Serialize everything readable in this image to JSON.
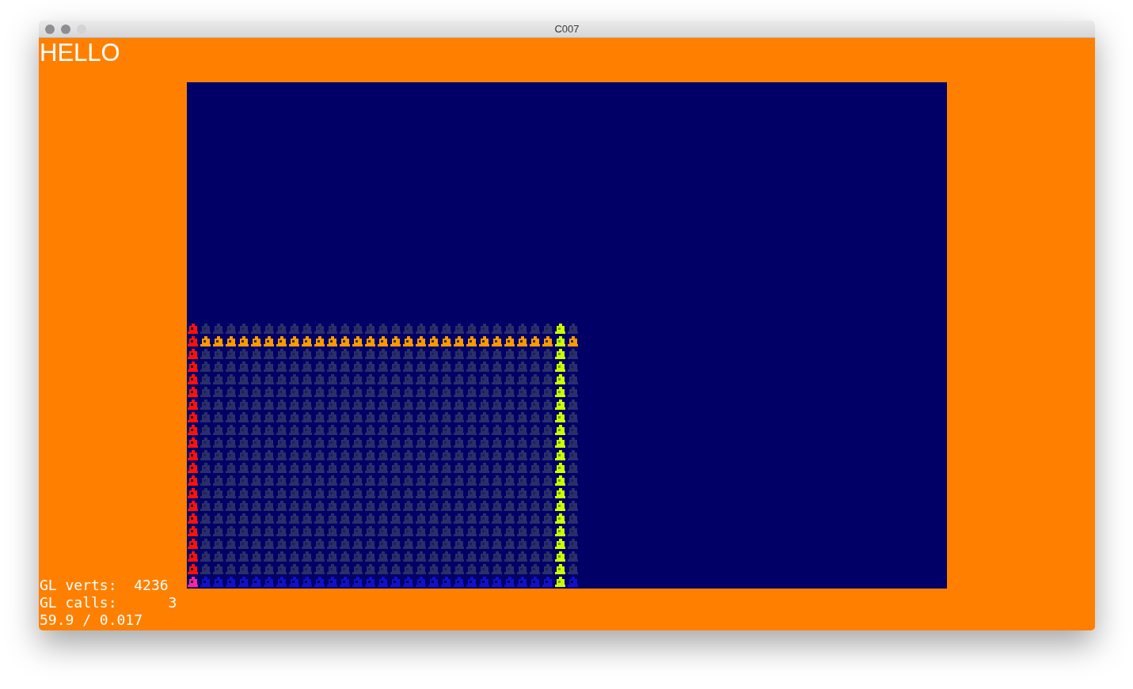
{
  "window": {
    "title": "C007"
  },
  "heading": "HELLO",
  "stats": [
    "GL verts:  4236",
    "GL calls:      3",
    "59.9 / 0.017"
  ]
}
